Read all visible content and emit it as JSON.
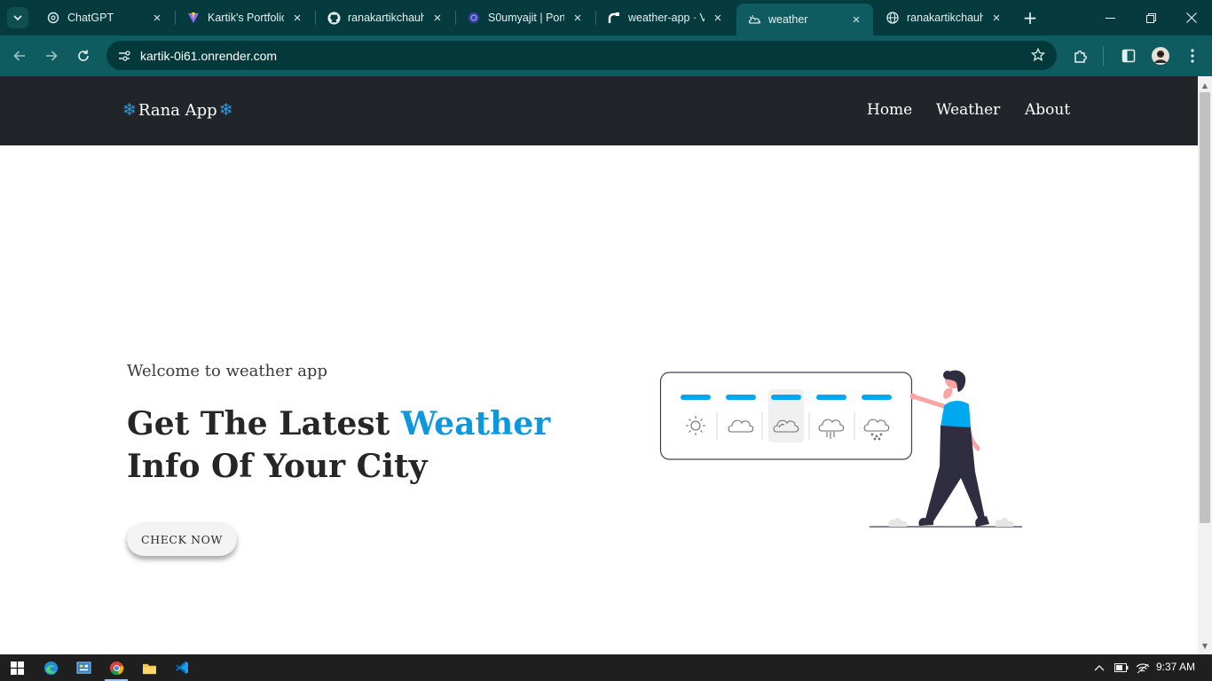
{
  "browser": {
    "tabs": [
      {
        "title": "ChatGPT",
        "icon": "chatgpt-icon"
      },
      {
        "title": "Kartik's Portfolio",
        "icon": "vite-icon"
      },
      {
        "title": "ranakartikchauh",
        "icon": "github-icon"
      },
      {
        "title": "S0umyajit | Portf",
        "icon": "portfolio-icon"
      },
      {
        "title": "weather-app · V",
        "icon": "render-icon"
      },
      {
        "title": "weather",
        "icon": "weather-cloud-icon",
        "active": true
      },
      {
        "title": "ranakartikchauh",
        "icon": "globe-icon"
      }
    ],
    "url": "kartik-0i61.onrender.com",
    "colors": {
      "tabstrip": "#053b3e",
      "toolbar": "#0f5c60",
      "omnibox": "#04393c"
    }
  },
  "navbar": {
    "brand": "Rana App",
    "brand_icon": "snowflake-icon",
    "links": [
      "Home",
      "Weather",
      "About"
    ]
  },
  "hero": {
    "subtitle": "Welcome to weather app",
    "title_pre": "Get The Latest ",
    "title_highlight": "Weather",
    "title_post": " Info Of Your City",
    "cta": "CHECK NOW",
    "accent": "#0d98de"
  },
  "illustration": {
    "weather_icons": [
      "sun-icon",
      "cloud-icon",
      "cloudy-icon",
      "rain-icon",
      "snow-icon"
    ],
    "selected_index": 2
  },
  "taskbar": {
    "apps": [
      "windows-start-icon",
      "edge-icon",
      "control-panel-icon",
      "chrome-icon",
      "file-explorer-icon",
      "vscode-icon"
    ],
    "time": "9:37 AM"
  }
}
